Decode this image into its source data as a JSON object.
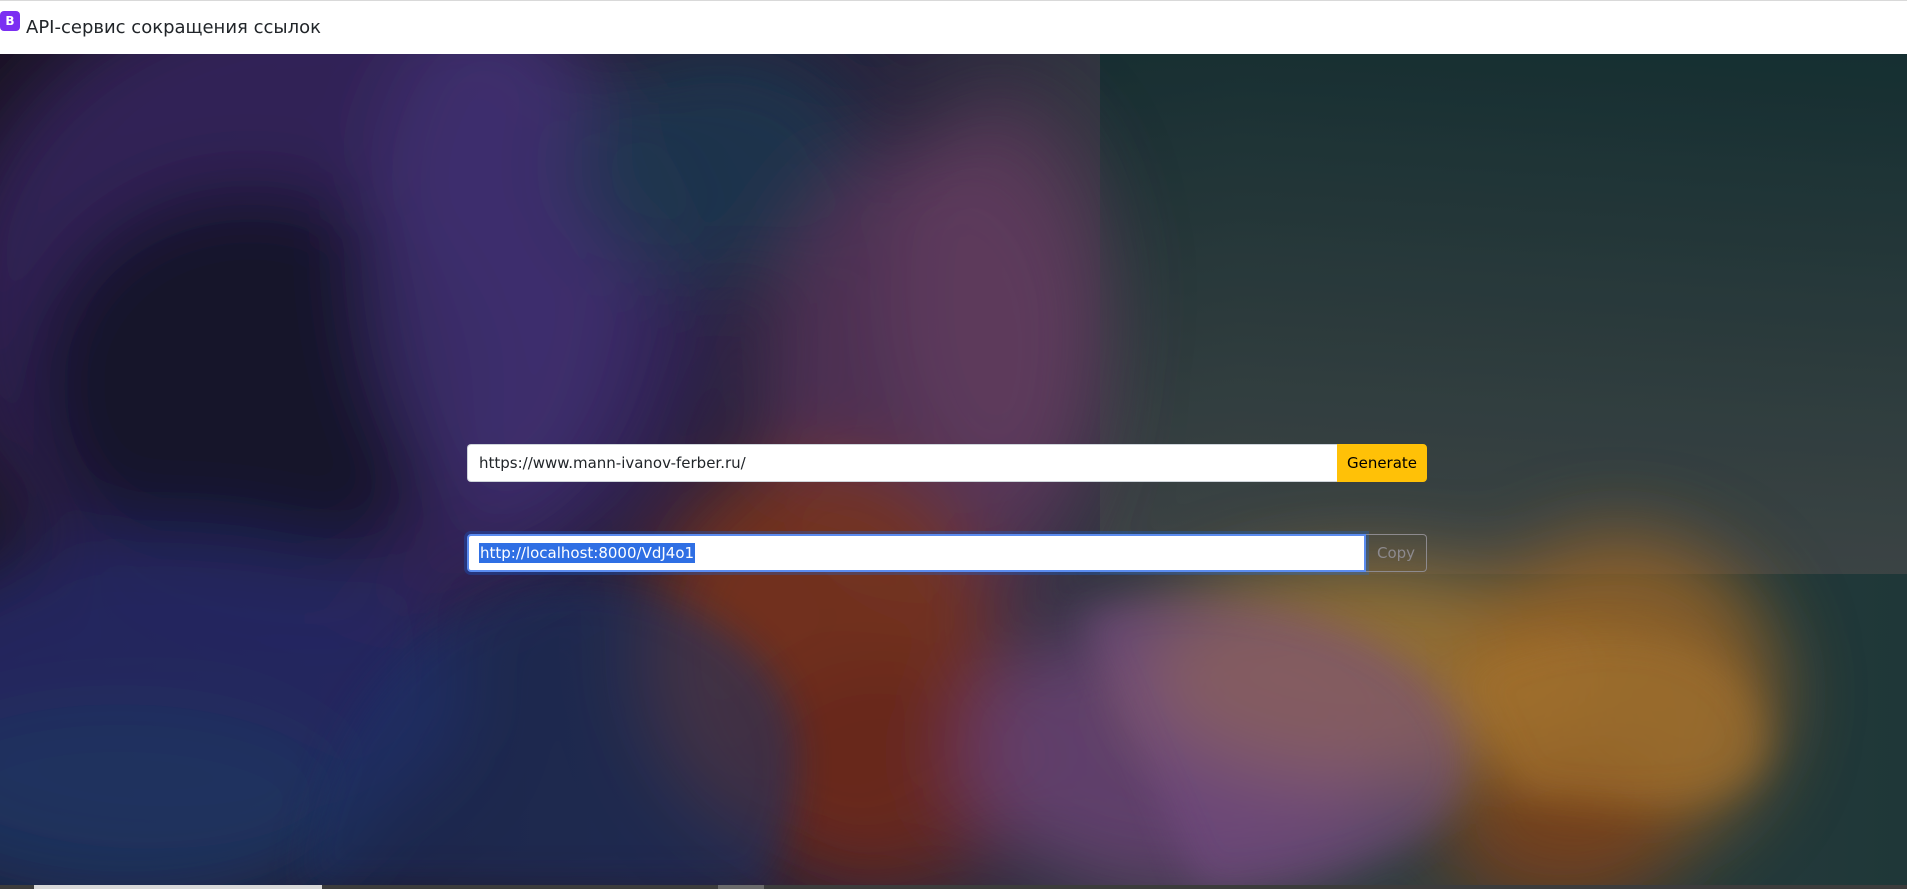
{
  "header": {
    "logo_letter": "B",
    "title": "API-сервис сокращения ссылок"
  },
  "shortener": {
    "url_value": "https://www.mann-ivanov-ferber.ru/",
    "generate_label": "Generate",
    "short_url": "http://localhost:8000/VdJ4o1",
    "copy_label": "Copy"
  },
  "colors": {
    "brand": "#7b2ff2",
    "generate_button": "#ffc107",
    "focus_border": "#5b8cf0",
    "selection": "#2f6fe4"
  }
}
